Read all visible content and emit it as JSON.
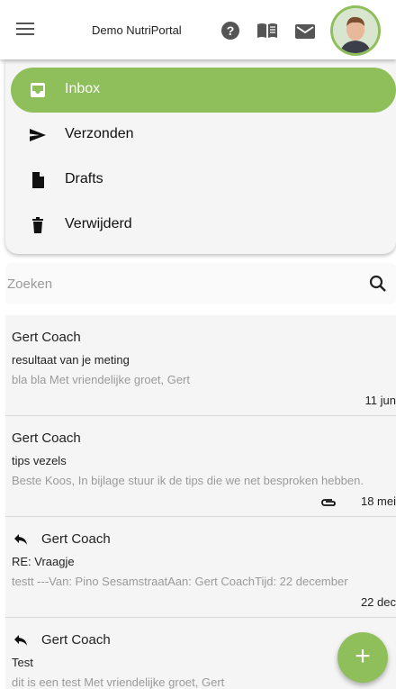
{
  "app": {
    "title": "Demo NutriPortal"
  },
  "header": {
    "help_glyph": "?",
    "icons": [
      "menu-icon",
      "help-icon",
      "book-icon",
      "mail-icon",
      "avatar"
    ]
  },
  "folders": [
    {
      "label": "Inbox",
      "icon": "inbox-icon",
      "active": true
    },
    {
      "label": "Verzonden",
      "icon": "send-icon",
      "active": false
    },
    {
      "label": "Drafts",
      "icon": "draft-icon",
      "active": false
    },
    {
      "label": "Verwijderd",
      "icon": "trash-icon",
      "active": false
    }
  ],
  "search": {
    "placeholder": "Zoeken"
  },
  "messages": [
    {
      "sender": "Gert Coach",
      "subject": "resultaat van je meting",
      "preview": "bla bla Met vriendelijke groet, Gert",
      "date": "11 jun",
      "reply": false,
      "attachment": false
    },
    {
      "sender": "Gert Coach",
      "subject": "tips vezels",
      "preview": "Beste Koos,   In bijlage stuur ik de tips die we net besproken hebben.",
      "date": "18 mei",
      "reply": false,
      "attachment": true
    },
    {
      "sender": "Gert Coach",
      "subject": "RE: Vraagje",
      "preview": "testt ---Van: Pino SesamstraatAan: Gert CoachTijd: 22 december",
      "date": "22 dec",
      "reply": true,
      "attachment": false
    },
    {
      "sender": "Gert Coach",
      "subject": "Test",
      "preview": "dit is een test Met vriendelijke groet, Gert",
      "date": "",
      "reply": true,
      "attachment": false
    }
  ],
  "fab": {
    "label": "+"
  },
  "colors": {
    "accent": "#8fbf5a",
    "panel": "#f5f5f5",
    "muted_text": "#9a9a9a"
  }
}
